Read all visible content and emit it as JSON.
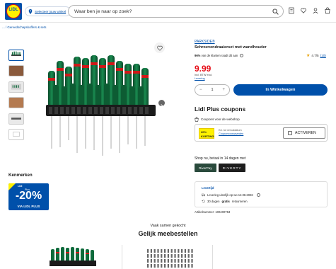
{
  "header": {
    "logo_text": "LIDL",
    "store_select": "Selecteer jouw winkel",
    "search_placeholder": "Waar ben je naar op zoek?"
  },
  "breadcrumb": "... / Gereedschapskoffers & sets",
  "product": {
    "brand": "PARKSIDE®",
    "title": "Schroevendraaierset met wandhouder",
    "recommend_pct": "96%",
    "recommend_text": "van de klanten raadt dit aan",
    "rating": "4.7/5",
    "review_count": "(10)",
    "price": "9.99",
    "price_note": "Incl. BTW excl.",
    "delivery_link": "Levering",
    "quantity": "1",
    "add_to_cart": "In Winkelwagen"
  },
  "coupons": {
    "title": "Lidl Plus coupons",
    "subtitle": "Coupons voor de webshop",
    "badge_pct": "20%",
    "badge_text": "KORTING",
    "desc": "Ed. tot vervaldatum",
    "conditions_link": "Couponvoorwaarden",
    "activate_label": "ACTIVEREN"
  },
  "payment": {
    "text": "Shop nu, betaal in 14 dagen met",
    "providers": [
      "RiverPay",
      "RIVERTY"
    ]
  },
  "delivery": {
    "heading": "Levertijd",
    "line1": "Levering uiterlijk op wo 12.08.2026",
    "line2_bold": "gratis",
    "line2_pre": "30 dagen",
    "line2_post": "retourneren",
    "article_no": "Artikelnummer: 100400753"
  },
  "features": {
    "heading": "Kenmerken",
    "promo_brand": "Lidl",
    "promo_plus": "Plus",
    "promo_pct": "-20%",
    "promo_via": "VIA LIDL PLUS"
  },
  "bundle": {
    "subtitle": "Vaak samen gekocht",
    "title": "Gelijk meebestellen"
  },
  "colors": {
    "lidl_blue": "#0050aa",
    "lidl_yellow": "#fff100",
    "lidl_red": "#e60a14",
    "parkside_green": "#0f6b3c"
  }
}
